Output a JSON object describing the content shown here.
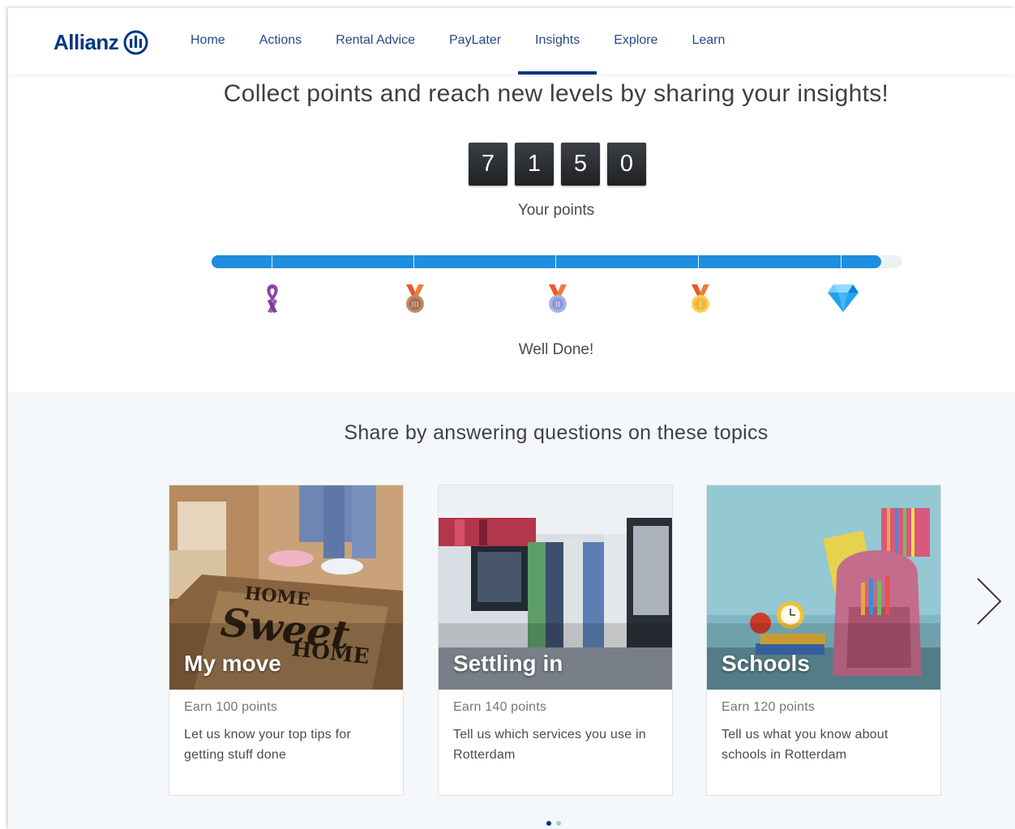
{
  "brand": {
    "name": "Allianz",
    "color": "#003781"
  },
  "nav": {
    "items": [
      {
        "label": "Home"
      },
      {
        "label": "Actions"
      },
      {
        "label": "Rental Advice"
      },
      {
        "label": "PayLater"
      },
      {
        "label": "Insights",
        "active": true
      },
      {
        "label": "Explore"
      },
      {
        "label": "Learn"
      }
    ]
  },
  "hero": {
    "title": "Collect points and reach new levels by sharing your insights!",
    "digits": [
      "7",
      "1",
      "5",
      "0"
    ],
    "points_label": "Your points",
    "progress_fraction": 0.97,
    "accent": "#1e8ede",
    "levels": [
      {
        "icon": "purple-ribbon-icon",
        "color": "#8e44ad"
      },
      {
        "icon": "bronze-medal-icon",
        "color": "#c08a6a"
      },
      {
        "icon": "silver-medal-icon",
        "color": "#9fa8da"
      },
      {
        "icon": "gold-medal-icon",
        "color": "#f1c24b"
      },
      {
        "icon": "diamond-icon",
        "color": "#1fa2f0"
      }
    ],
    "status": "Well Done!"
  },
  "topics": {
    "title": "Share by answering questions on these topics",
    "cards": [
      {
        "title": "My move",
        "points": "Earn 100 points",
        "description": "Let us know your top tips for getting stuff done",
        "image": "home-sweet-home-doormat"
      },
      {
        "title": "Settling in",
        "points": "Earn 140 points",
        "description": "Tell us which services you use in Rotterdam",
        "image": "office-binders"
      },
      {
        "title": "Schools",
        "points": "Earn 120 points",
        "description": "Tell us what you know about schools in Rotterdam",
        "image": "school-backpack"
      }
    ],
    "pager": {
      "active_index": 0,
      "count": 2
    }
  }
}
